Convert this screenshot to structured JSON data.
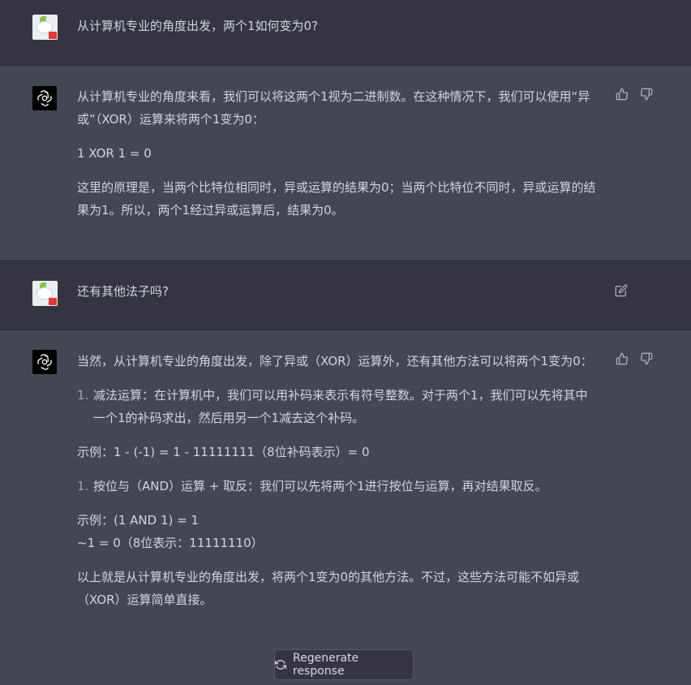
{
  "conversation": {
    "q1": "从计算机专业的角度出发，两个1如何变为0?",
    "a1": {
      "p1": "从计算机专业的角度来看，我们可以将这两个1视为二进制数。在这种情况下，我们可以使用“异或”（XOR）运算来将两个1变为0：",
      "p2": "1 XOR 1 = 0",
      "p3": "这里的原理是，当两个比特位相同时，异或运算的结果为0；当两个比特位不同时，异或运算的结果为1。所以，两个1经过异或运算后，结果为0。"
    },
    "q2": "还有其他法子吗?",
    "a2": {
      "intro": "当然，从计算机专业的角度出发，除了异或（XOR）运算外，还有其他方法可以将两个1变为0：",
      "item1_num": "1.",
      "item1_text": "减法运算：在计算机中，我们可以用补码来表示有符号整数。对于两个1，我们可以先将其中一个1的补码求出，然后用另一个1减去这个补码。",
      "example1": "示例：1 - (-1) = 1 - 11111111（8位补码表示）= 0",
      "item2_num": "1.",
      "item2_text": "按位与（AND）运算 + 取反：我们可以先将两个1进行按位与运算，再对结果取反。",
      "example2_line1": "示例：(1 AND 1) = 1",
      "example2_line2": "~1 = 0（8位表示：11111110）",
      "conclusion": "以上就是从计算机专业的角度出发，将两个1变为0的其他方法。不过，这些方法可能不如异或（XOR）运算简单直接。"
    }
  },
  "regenerate_label": "Regenerate response",
  "icons": {
    "thumbs_up": "thumbs-up-icon",
    "thumbs_down": "thumbs-down-icon",
    "edit": "edit-icon",
    "refresh": "refresh-icon",
    "openai_logo": "openai-logo-icon"
  }
}
